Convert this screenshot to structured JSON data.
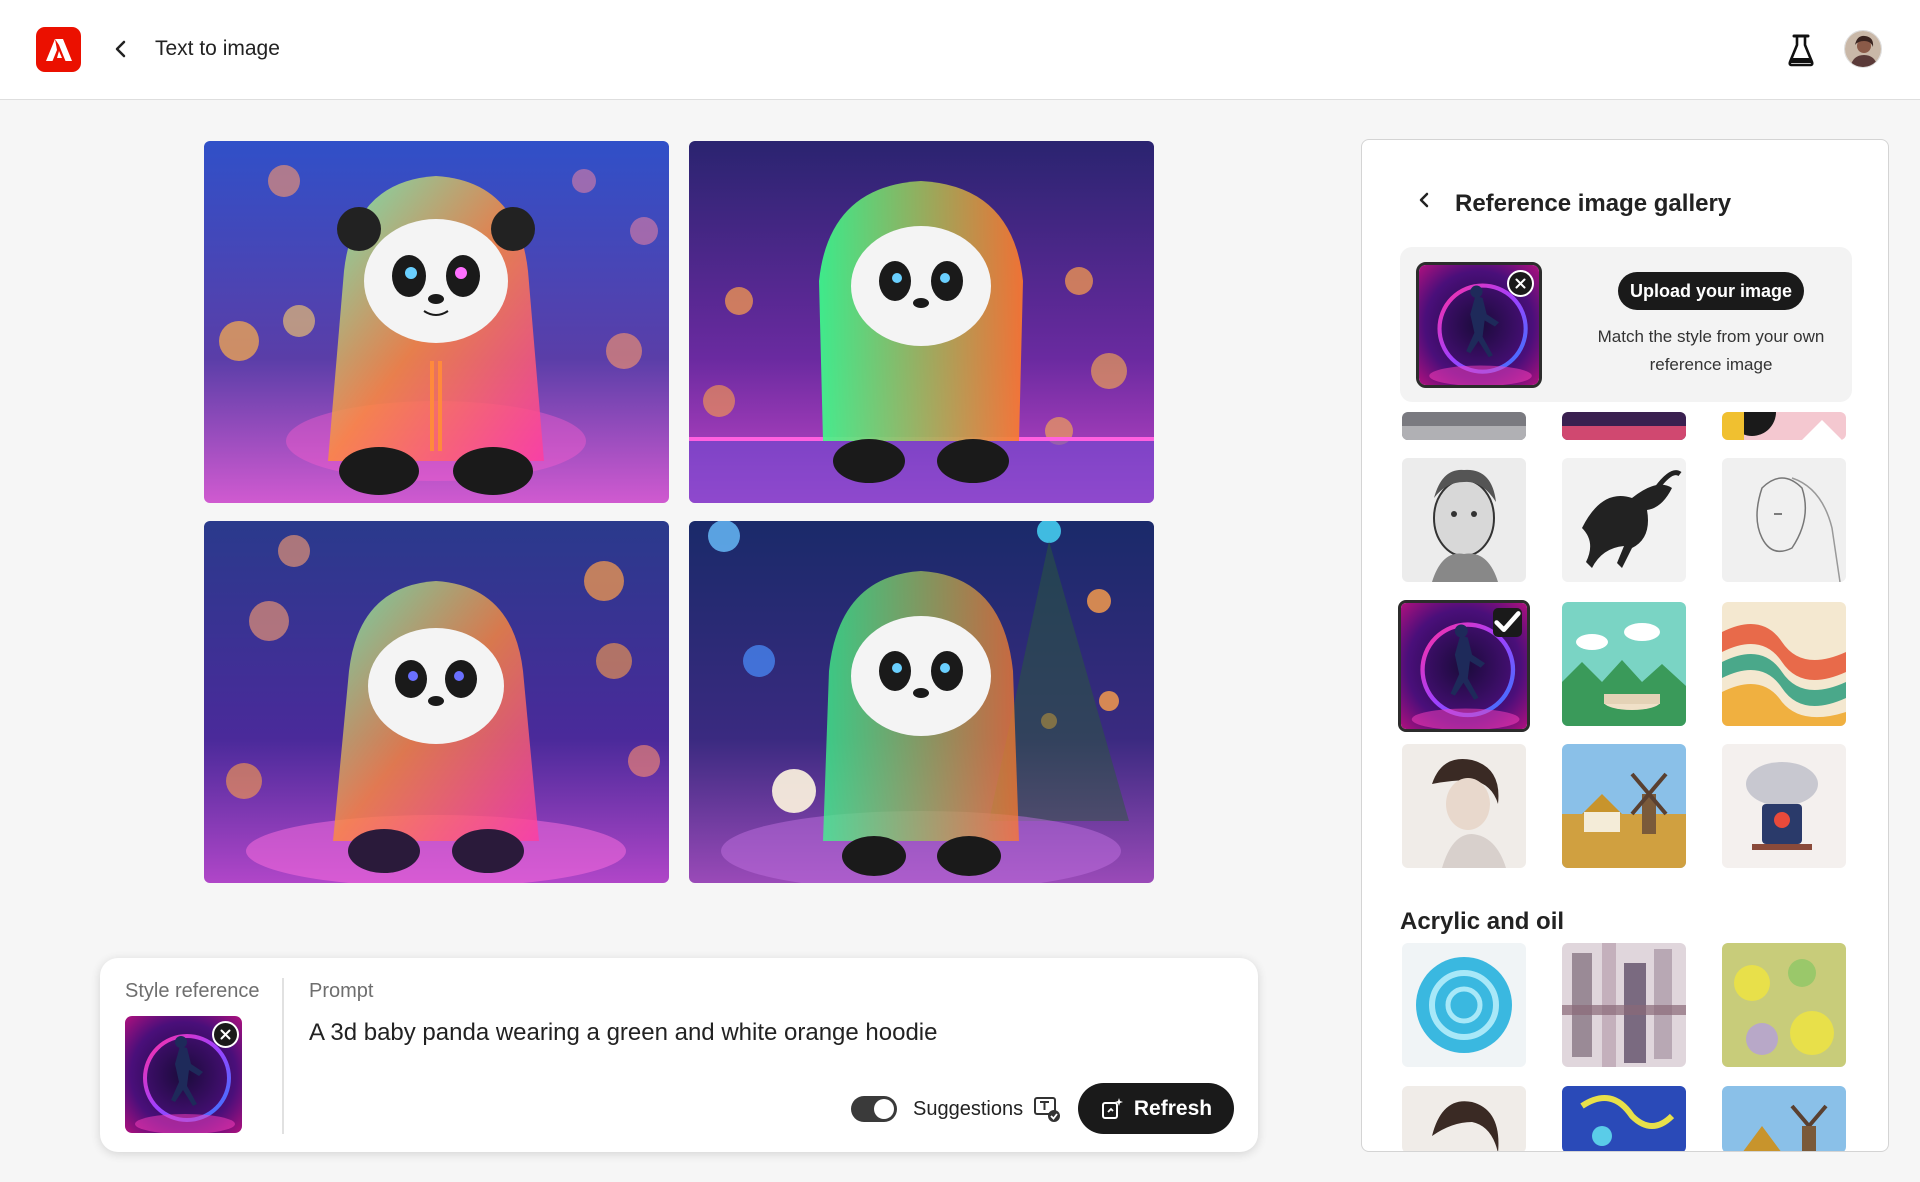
{
  "header": {
    "app_title": "Text to image",
    "icons": {
      "logo": "adobe-logo",
      "back": "chevron-left-icon",
      "labs": "beaker-icon",
      "avatar": "user-avatar"
    }
  },
  "results": {
    "images": [
      {
        "name": "panda-result-1",
        "alt": "Generated panda image 1"
      },
      {
        "name": "panda-result-2",
        "alt": "Generated panda image 2"
      },
      {
        "name": "panda-result-3",
        "alt": "Generated panda image 3"
      },
      {
        "name": "panda-result-4",
        "alt": "Generated panda image 4"
      }
    ]
  },
  "prompt_card": {
    "style_reference_label": "Style reference",
    "prompt_label": "Prompt",
    "prompt_text": "A 3d baby panda wearing a green and white orange hoodie",
    "suggestions_label": "Suggestions",
    "suggestions_enabled": true,
    "refresh_label": "Refresh"
  },
  "gallery": {
    "title": "Reference image gallery",
    "upload_button": "Upload your image",
    "upload_description": "Match the style from your own reference image",
    "section_acrylic": "Acrylic and oil",
    "selected_thumbnail": "neon-dancer"
  },
  "colors": {
    "accent": "#eb1000",
    "dark_button": "#1a1a1a",
    "page_bg": "#f6f6f6"
  }
}
